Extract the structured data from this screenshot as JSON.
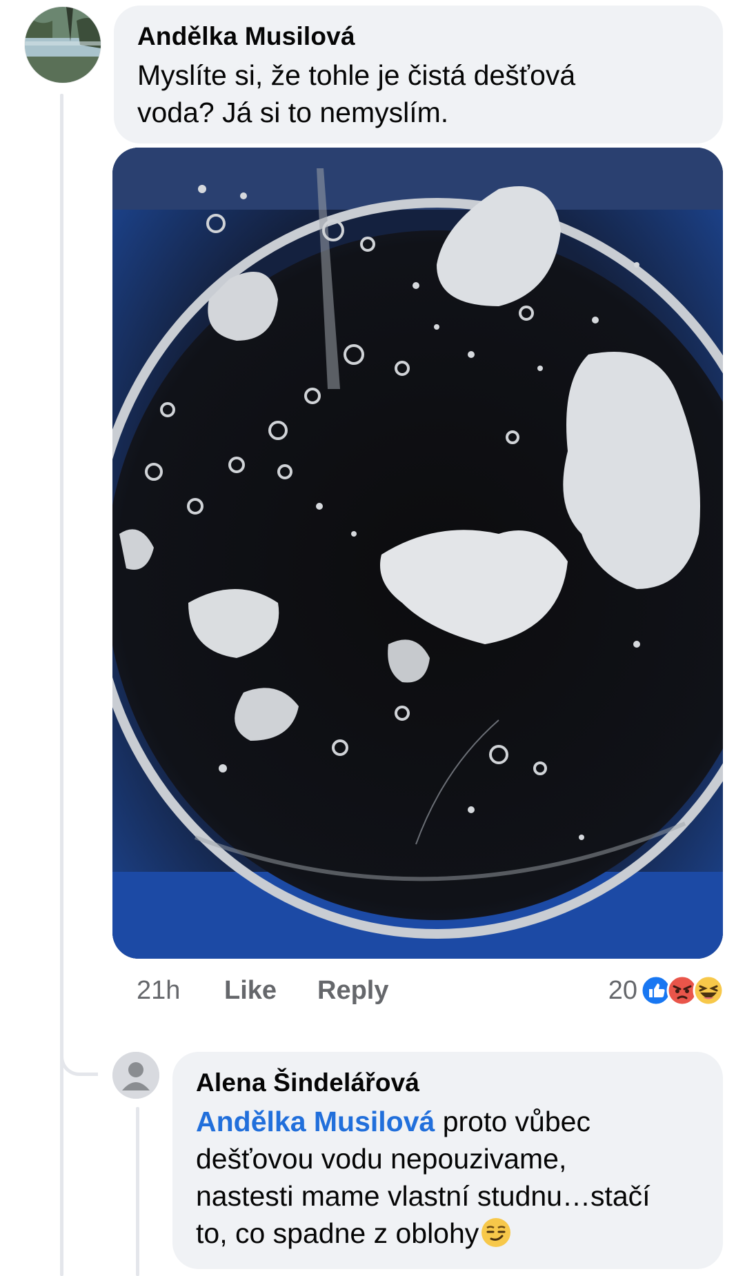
{
  "comment": {
    "author": "Andělka Musilová",
    "text_line1": "Myslíte si, že  tohle je čistá dešťová",
    "text_line2": "voda? Já si to nemyslím.",
    "time": "21h",
    "like_label": "Like",
    "reply_label": "Reply",
    "reaction_count": "20",
    "reaction_icons": [
      "like-icon",
      "angry-icon",
      "haha-icon"
    ],
    "photo_icon": "rain-barrel-water-photo"
  },
  "reply": {
    "author": "Alena Šindelářová",
    "mention": "Andělka Musilová",
    "text_line1": " proto vůbec",
    "text_line2": "dešťovou vodu nepouzivame,",
    "text_line3": "nastesti mame vlastní studnu…stačí",
    "text_line4": "to, co spadne z oblohy",
    "emoji": "smirk-emoji"
  },
  "colors": {
    "bubble": "#f0f2f5",
    "mention": "#216fdb",
    "meta": "#65676b",
    "like_blue": "#1877f2",
    "angry_red": "#e9554a",
    "haha_yellow": "#f7c84a"
  }
}
